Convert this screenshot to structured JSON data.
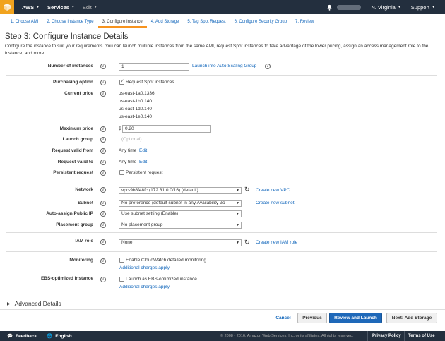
{
  "nav": {
    "services": "Services",
    "edit": "Edit",
    "region": "N. Virginia",
    "support": "Support",
    "brand": "AWS"
  },
  "tabs": [
    "1. Choose AMI",
    "2. Choose Instance Type",
    "3. Configure Instance",
    "4. Add Storage",
    "5. Tag Spot Request",
    "6. Configure Security Group",
    "7. Review"
  ],
  "page": {
    "title": "Step 3: Configure Instance Details",
    "description": "Configure the instance to suit your requirements. You can launch multiple instances from the same AMI, request Spot instances to take advantage of the lower pricing, assign an access management role to the instance, and more."
  },
  "form": {
    "num_instances_label": "Number of instances",
    "num_instances_value": "1",
    "auto_scaling_link": "Launch into Auto Scaling Group",
    "purchasing_label": "Purchasing option",
    "request_spot": "Request Spot instances",
    "current_price_label": "Current price",
    "prices": [
      "us-east-1a0.1336",
      "us-east-1b0.140",
      "us-east-1d0.140",
      "us-east-1e0.140"
    ],
    "max_price_label": "Maximum price",
    "currency": "$",
    "max_price_value": "0.20",
    "launch_group_label": "Launch group",
    "launch_group_placeholder": "(Optional)",
    "valid_from_label": "Request valid from",
    "valid_from_value": "Any time",
    "valid_to_label": "Request valid to",
    "valid_to_value": "Any time",
    "edit": "Edit",
    "persistent_label": "Persistent request",
    "persistent_text": "Persistent request",
    "network_label": "Network",
    "network_value": "vpc-9b8f48fc (172.31.0.0/16) (default)",
    "create_vpc": "Create new VPC",
    "subnet_label": "Subnet",
    "subnet_value": "No preference (default subnet in any Availability Zo",
    "create_subnet": "Create new subnet",
    "public_ip_label": "Auto-assign Public IP",
    "public_ip_value": "Use subnet setting (Enable)",
    "placement_label": "Placement group",
    "placement_value": "No placement group",
    "iam_label": "IAM role",
    "iam_value": "None",
    "create_iam": "Create new IAM role",
    "monitoring_label": "Monitoring",
    "monitoring_text": "Enable CloudWatch detailed monitoring",
    "additional_charges": "Additional charges apply.",
    "ebs_label": "EBS-optimized instance",
    "ebs_text": "Launch as EBS-optimized instance",
    "advanced": "Advanced Details"
  },
  "buttons": {
    "cancel": "Cancel",
    "previous": "Previous",
    "review": "Review and Launch",
    "next": "Next: Add Storage"
  },
  "footer": {
    "feedback": "Feedback",
    "language": "English",
    "copyright": "© 2008 - 2016, Amazon Web Services, Inc. or its affiliates. All rights reserved.",
    "privacy": "Privacy Policy",
    "terms": "Terms of Use"
  },
  "colors": {
    "nav_bg": "#232f3e",
    "accent_orange": "#f7931e",
    "link_blue": "#1166bb",
    "primary_button": "#1e68b9"
  }
}
